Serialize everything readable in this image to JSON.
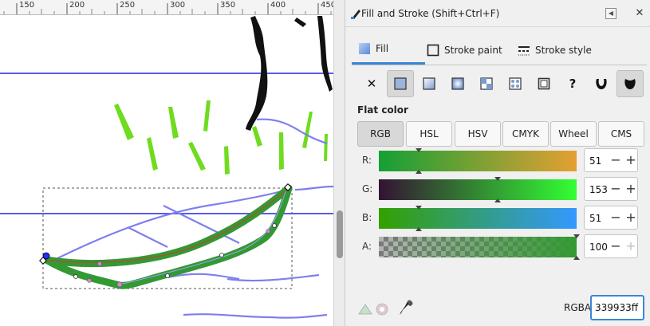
{
  "ruler": {
    "ticks": [
      "150",
      "200",
      "250",
      "300",
      "350",
      "400",
      "450"
    ]
  },
  "dialog": {
    "title": "Fill and Stroke (Shift+Ctrl+F)",
    "collapse_icon": "collapse-left-icon",
    "close_icon": "close-icon"
  },
  "tabs": [
    {
      "label": "Fill",
      "icon": "fill-gradient-icon",
      "active": true
    },
    {
      "label": "Stroke paint",
      "icon": "stroke-paint-icon",
      "active": false
    },
    {
      "label": "Stroke style",
      "icon": "stroke-style-icon",
      "active": false
    }
  ],
  "fill_types": [
    {
      "name": "no-paint",
      "glyph": "✕"
    },
    {
      "name": "flat-color",
      "selected": true
    },
    {
      "name": "linear-gradient"
    },
    {
      "name": "radial-gradient"
    },
    {
      "name": "pattern"
    },
    {
      "name": "swatch"
    },
    {
      "name": "mesh"
    },
    {
      "name": "unset",
      "glyph": "?"
    },
    {
      "name": "fill-rule-evenodd"
    },
    {
      "name": "fill-rule-nonzero",
      "selected": true
    }
  ],
  "flat_color_label": "Flat color",
  "color_modes": [
    {
      "label": "RGB",
      "selected": true
    },
    {
      "label": "HSL"
    },
    {
      "label": "HSV"
    },
    {
      "label": "CMYK"
    },
    {
      "label": "Wheel"
    },
    {
      "label": "CMS"
    }
  ],
  "channels": [
    {
      "label": "R:",
      "value": "51",
      "fraction": 0.2,
      "gradient": [
        "#13a035",
        "#e4a033"
      ]
    },
    {
      "label": "G:",
      "value": "153",
      "fraction": 0.6,
      "gradient": [
        "#331333",
        "#33ff33"
      ]
    },
    {
      "label": "B:",
      "value": "51",
      "fraction": 0.2,
      "gradient": [
        "#33a000",
        "#3399ff"
      ]
    },
    {
      "label": "A:",
      "value": "100",
      "fraction": 1.0,
      "gradient": [
        "#339933",
        "#339933"
      ],
      "checker": true
    }
  ],
  "bottom": {
    "rgba_label": "RGBA:",
    "rgba_value": "339933ff",
    "icons": [
      "color-managed-icon",
      "out-of-gamut-icon",
      "eyedropper-icon"
    ]
  },
  "colors": {
    "accent": "#3c86d8",
    "guide": "#5b5bea",
    "blade": "#6fdc1f",
    "path_fill": "#339933",
    "centerline": "#d23838"
  }
}
